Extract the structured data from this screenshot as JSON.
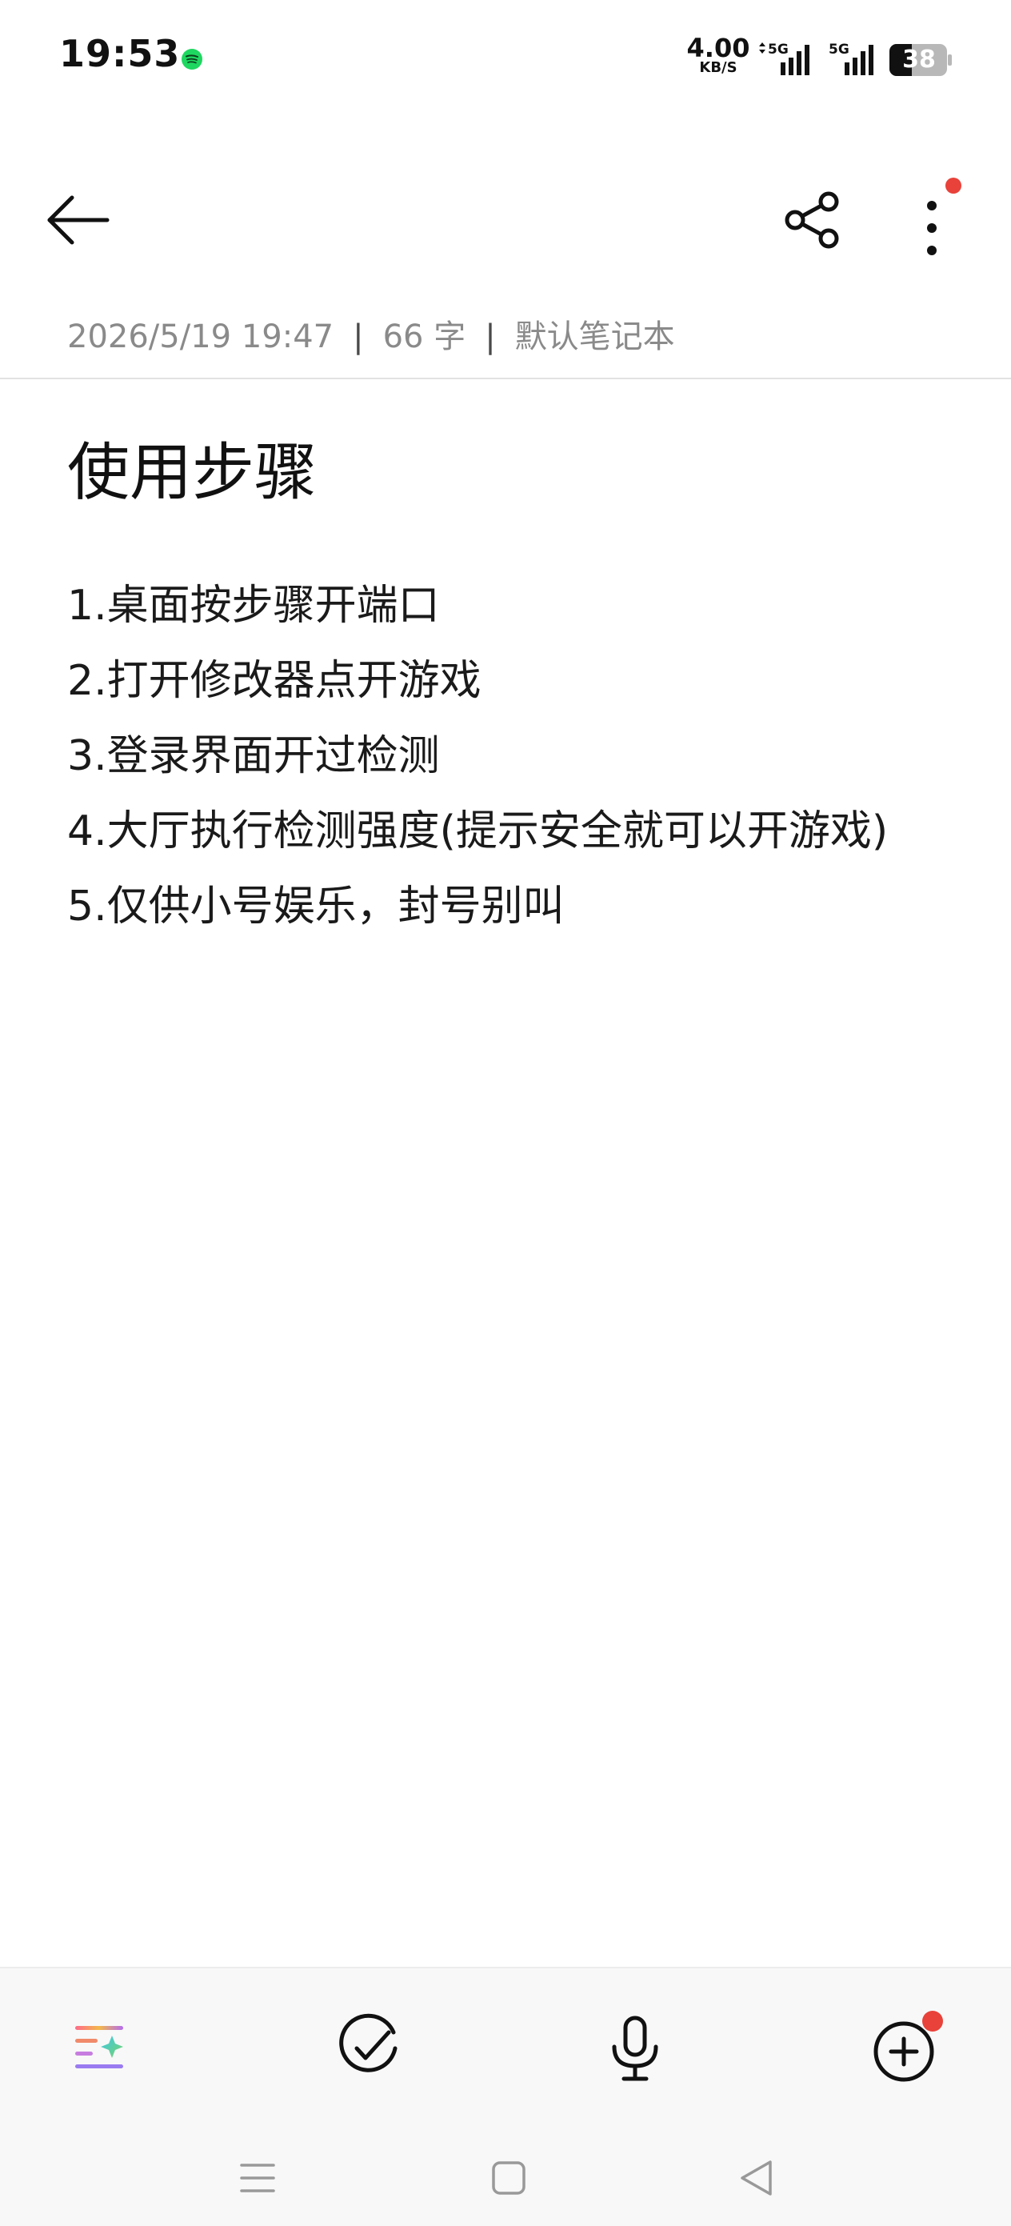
{
  "status_bar": {
    "time": "19:53",
    "net_speed_value": "4.00",
    "net_speed_unit": "KB/S",
    "signal_1_label": "5G",
    "signal_2_label": "5G",
    "battery": "38",
    "notification_icon": "spotify-icon"
  },
  "toolbar": {
    "back_icon": "arrow-left-icon",
    "share_icon": "share-icon",
    "more_icon": "more-vertical-icon",
    "more_has_badge": true
  },
  "note": {
    "meta_date": "2026/5/19 19:47",
    "meta_separator": "|",
    "meta_words": "66 字",
    "meta_notebook": "默认笔记本",
    "title": "使用步骤",
    "lines": [
      "1.桌面按步骤开端口",
      "2.打开修改器点开游戏",
      "3.登录界面开过检测",
      "4.大厅执行检测强度(提示安全就可以开游戏)",
      "5.仅供小号娱乐，封号别叫"
    ]
  },
  "bottom_toolbar": {
    "items": [
      {
        "icon": "ai-format-icon"
      },
      {
        "icon": "checklist-icon"
      },
      {
        "icon": "microphone-icon"
      },
      {
        "icon": "add-circle-icon",
        "badge": true
      }
    ]
  },
  "nav_bar": {
    "items": [
      {
        "icon": "menu-icon"
      },
      {
        "icon": "home-square-icon"
      },
      {
        "icon": "back-triangle-icon"
      }
    ]
  },
  "colors": {
    "badge": "#e8423a",
    "spotify": "#1ed760",
    "meta_text": "#8a8a8a",
    "text": "#1a1a1a"
  }
}
